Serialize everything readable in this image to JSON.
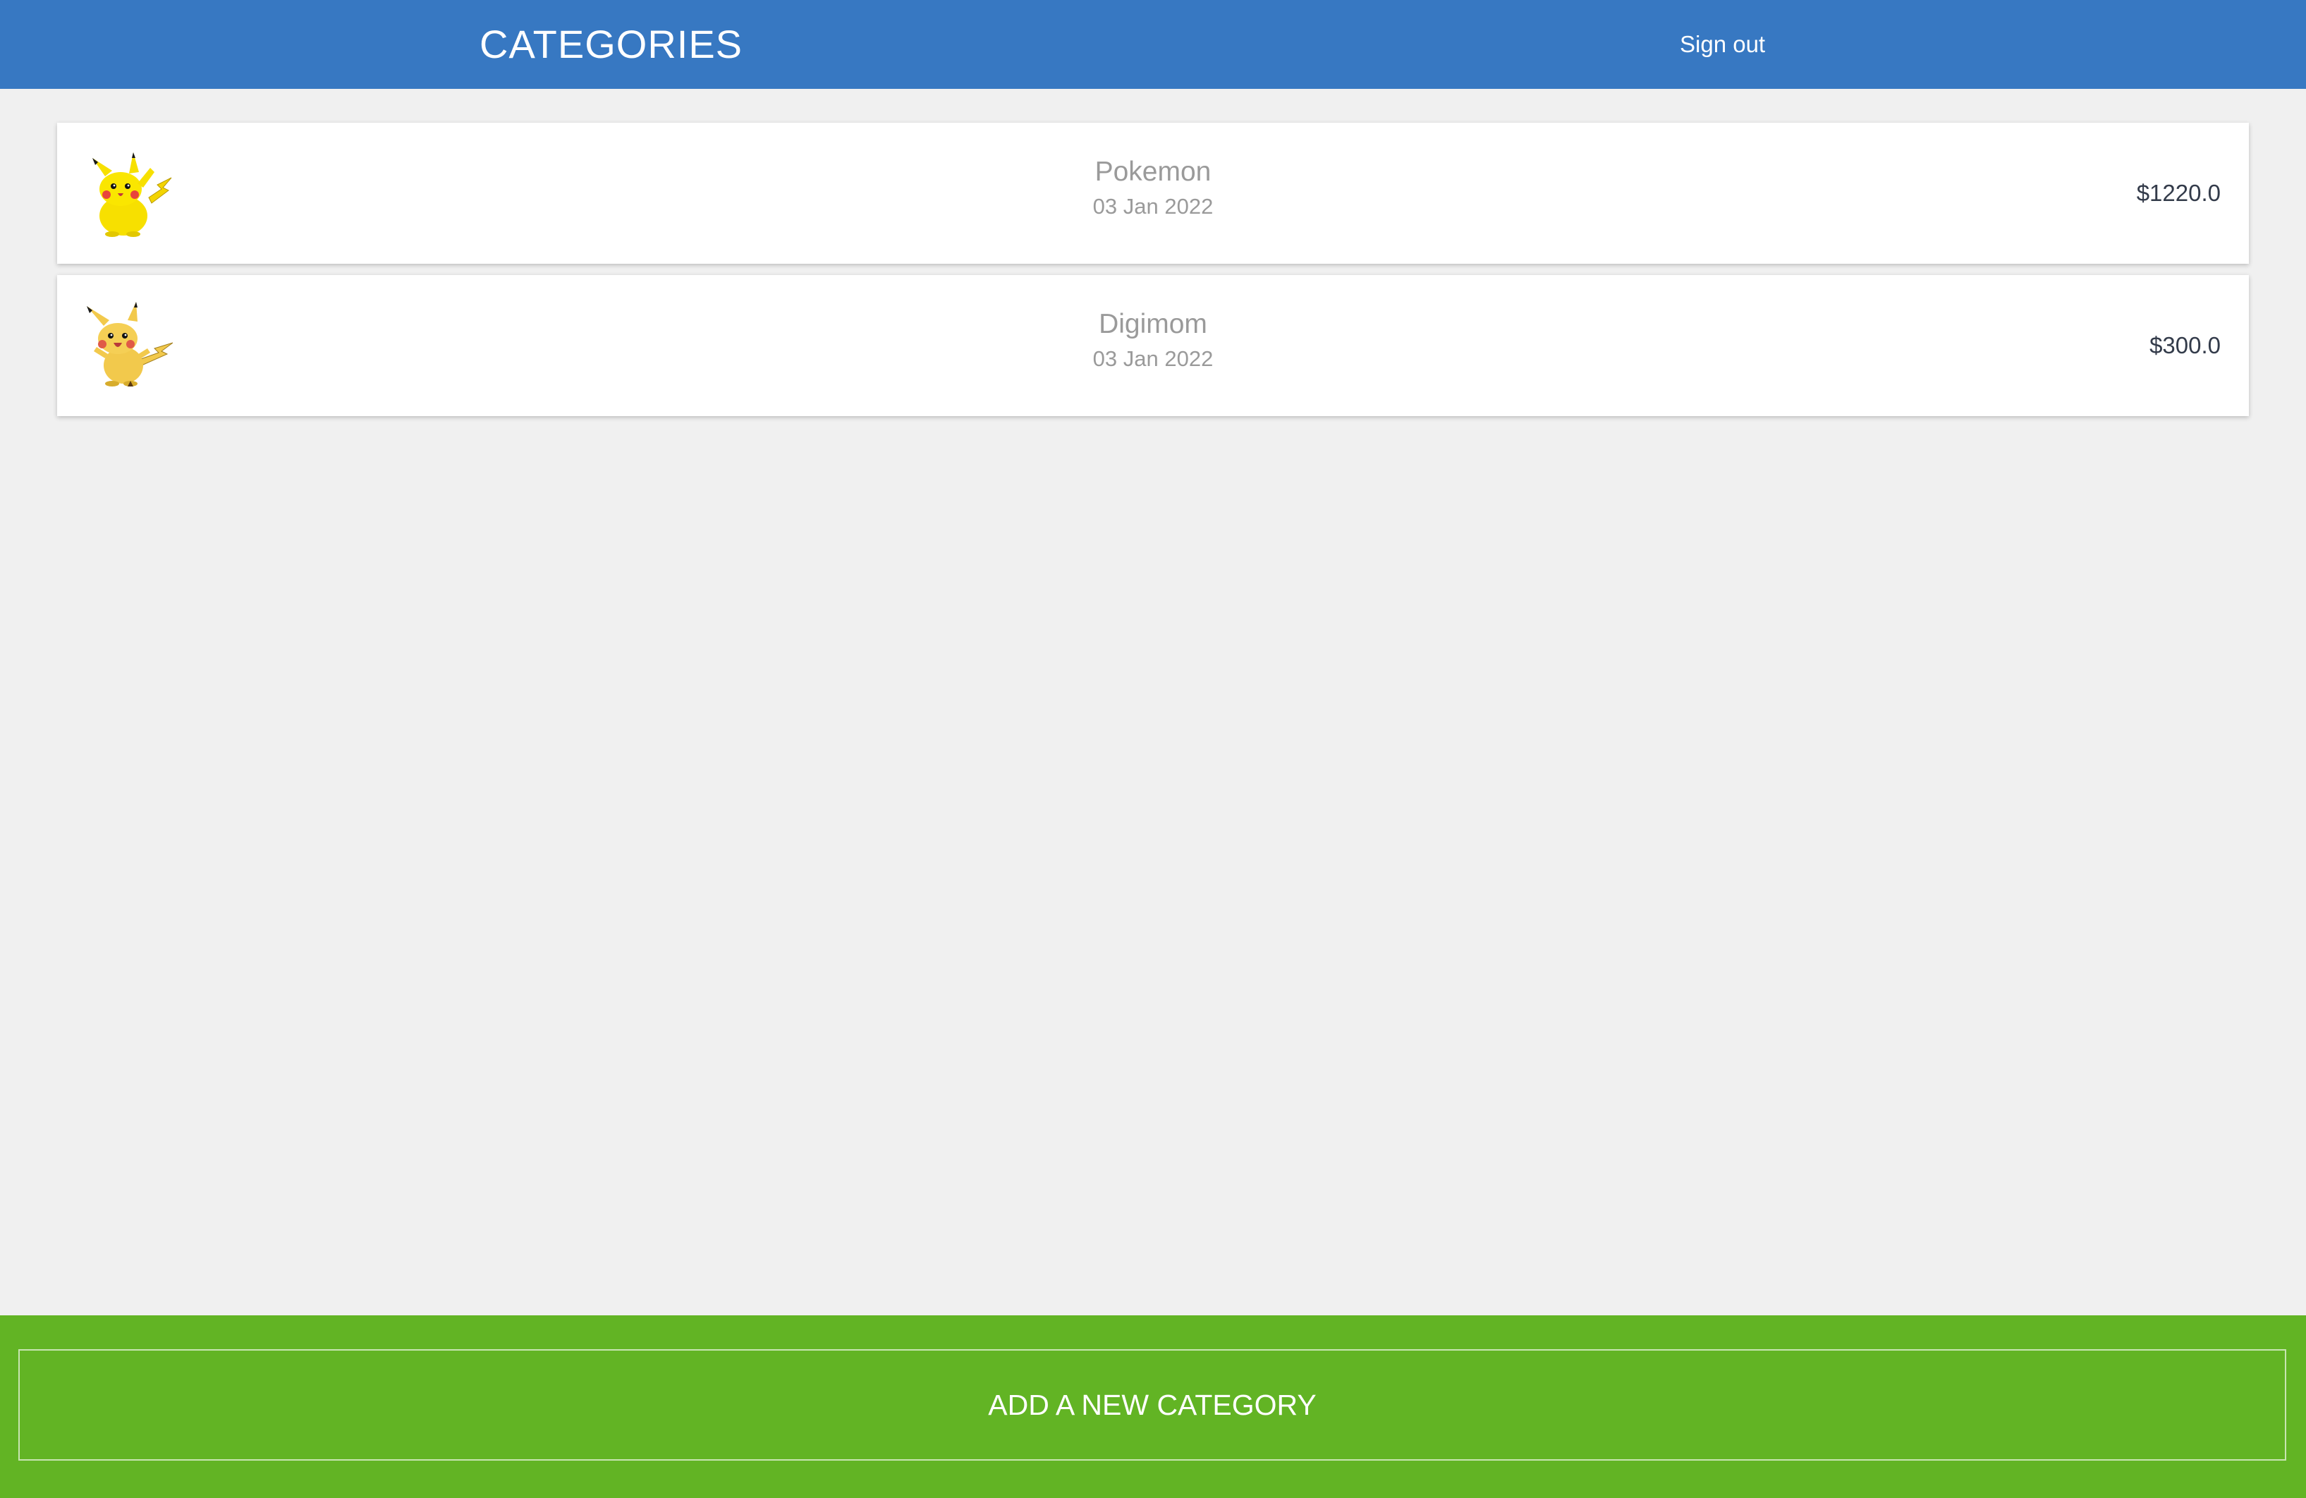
{
  "header": {
    "title": "CATEGORIES",
    "signout_label": "Sign out",
    "color": "#3778c2"
  },
  "categories": [
    {
      "icon": "pikachu-icon",
      "name": "Pokemon",
      "date": "03 Jan 2022",
      "amount": "$1220.0"
    },
    {
      "icon": "pikachu-icon",
      "name": "Digimom",
      "date": "03 Jan 2022",
      "amount": "$300.0"
    }
  ],
  "footer": {
    "add_label": "ADD A NEW CATEGORY",
    "color": "#62b424"
  }
}
